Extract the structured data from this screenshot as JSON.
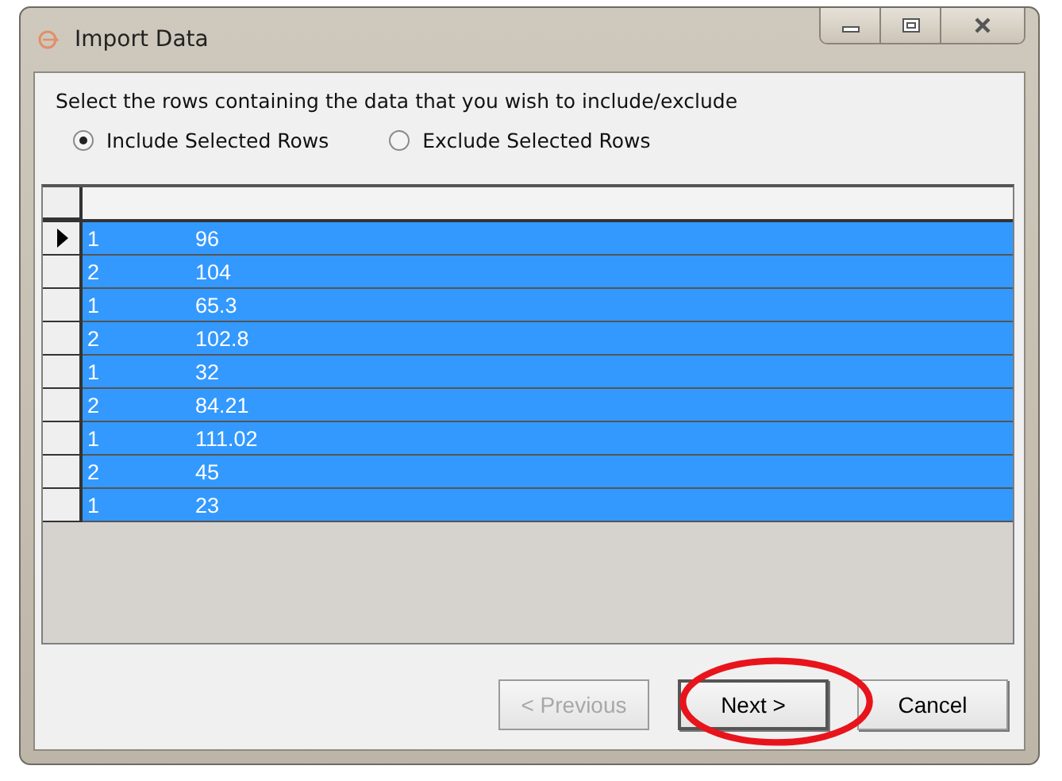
{
  "window": {
    "title": "Import Data"
  },
  "instruction": "Select the rows containing the data that you wish to include/exclude",
  "options": [
    {
      "label": "Include Selected Rows",
      "selected": true
    },
    {
      "label": "Exclude Selected Rows",
      "selected": false
    }
  ],
  "grid": {
    "rows": [
      {
        "current": true,
        "selected": true,
        "cells": [
          "1",
          "96"
        ]
      },
      {
        "current": false,
        "selected": true,
        "cells": [
          "2",
          "104"
        ]
      },
      {
        "current": false,
        "selected": true,
        "cells": [
          "1",
          "65.3"
        ]
      },
      {
        "current": false,
        "selected": true,
        "cells": [
          "2",
          "102.8"
        ]
      },
      {
        "current": false,
        "selected": true,
        "cells": [
          "1",
          "32"
        ]
      },
      {
        "current": false,
        "selected": true,
        "cells": [
          "2",
          "84.21"
        ]
      },
      {
        "current": false,
        "selected": true,
        "cells": [
          "1",
          "111.02"
        ]
      },
      {
        "current": false,
        "selected": true,
        "cells": [
          "2",
          "45"
        ]
      },
      {
        "current": false,
        "selected": true,
        "cells": [
          "1",
          "23"
        ]
      }
    ]
  },
  "buttons": [
    {
      "label": "< Previous",
      "disabled": true,
      "default": false
    },
    {
      "label": "Next >",
      "disabled": false,
      "default": true
    },
    {
      "label": "Cancel",
      "disabled": false,
      "default": false
    }
  ],
  "annotation": {
    "kind": "ellipse",
    "color": "#e8141b"
  }
}
